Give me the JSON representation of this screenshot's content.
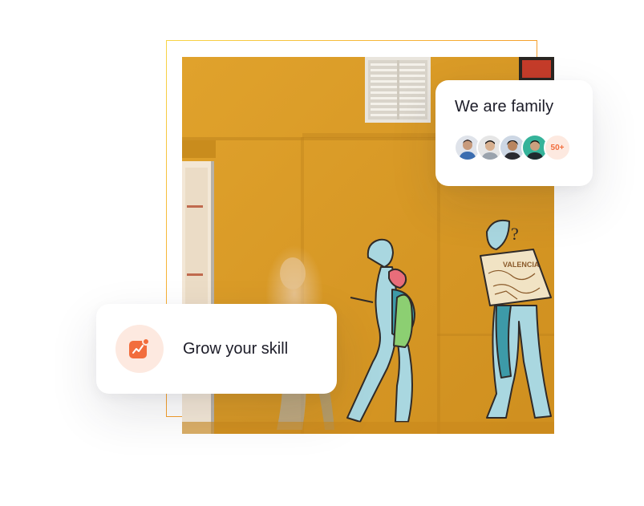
{
  "family_card": {
    "title": "We are family",
    "avatars": [
      "avatar-1",
      "avatar-2",
      "avatar-3",
      "avatar-4"
    ],
    "more_count": "50+"
  },
  "grow_card": {
    "label": "Grow your skill",
    "icon": "trending-up-chart-icon"
  },
  "photo": {
    "mural_map_text": "VALENCIA"
  },
  "colors": {
    "accent": "#f26d3d",
    "accent_soft": "#fde9e0",
    "wall": "#d99a26",
    "frame_gradient": [
      "#f7d547",
      "#f59a2a",
      "#e8612c"
    ]
  }
}
